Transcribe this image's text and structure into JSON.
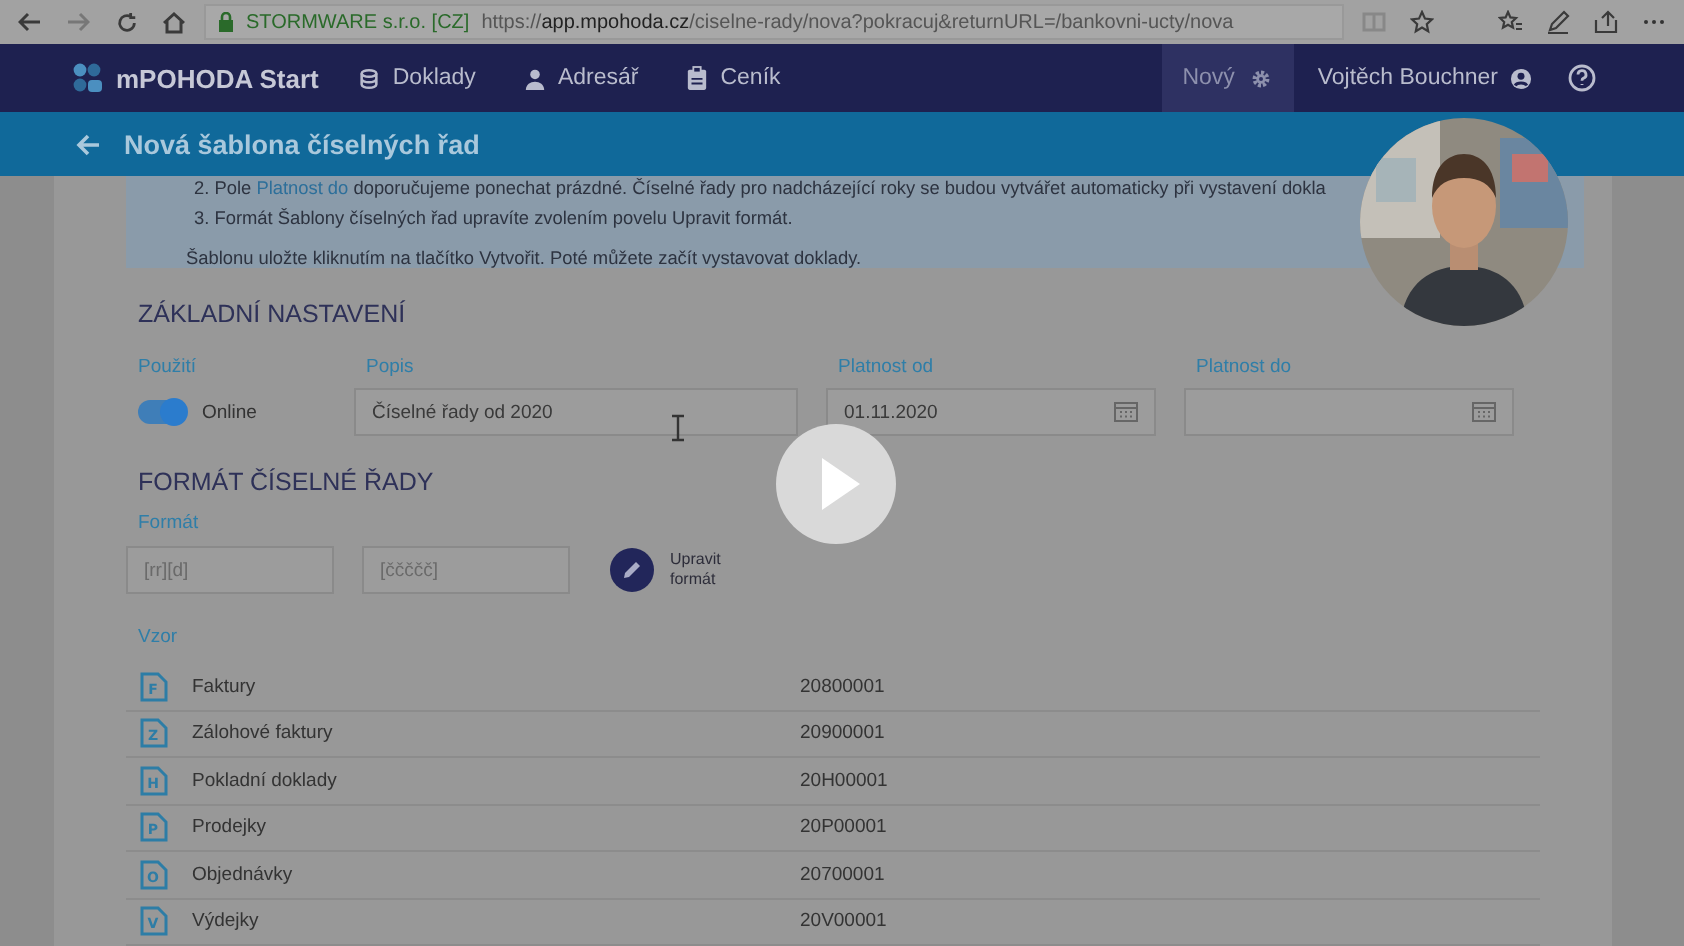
{
  "browser": {
    "site_identity": "STORMWARE s.r.o. [CZ]",
    "url": "https://**app.mpohoda.cz**/ciselne-rady/nova?pokracuj&returnURL=/bankovni-ucty/nova"
  },
  "nav": {
    "brand": "mPOHODA Start",
    "items": [
      {
        "label": "Doklady"
      },
      {
        "label": "Adresář"
      },
      {
        "label": "Ceník"
      }
    ],
    "new_button": "Nový",
    "user": "Vojtěch Bouchner"
  },
  "page_title": "Nová šablona číselných řad",
  "info": {
    "items": [
      {
        "number": "2.",
        "before": "Pole",
        "link": "Platnost do",
        "after": "doporučujeme ponechat prázdné. Číselné řady pro nadcházející roky se budou vytvářet automaticky při vystavení dokla"
      },
      {
        "number": "3.",
        "before": "Formát Šablony číselných řad upravíte zvolením povelu Upravit formát."
      }
    ],
    "note": "Šablonu uložte kliknutím na tlačítko Vytvořit. Poté můžete začít vystavovat doklady."
  },
  "basic": {
    "title": "ZÁKLADNÍ NASTAVENÍ",
    "usage": {
      "label": "Použití",
      "on": true,
      "text": "Online"
    },
    "fields": [
      {
        "kind": "text",
        "label": "Popis",
        "value": "Číselné řady od 2020"
      },
      {
        "kind": "date",
        "label": "Platnost od",
        "value": "01.11.2020"
      },
      {
        "kind": "date",
        "label": "Platnost do"
      }
    ]
  },
  "format": {
    "title": "FORMÁT ČÍSELNÉ ŘADY",
    "label": "Formát",
    "fields": [
      {
        "placeholder": "[rr][d]"
      },
      {
        "placeholder": "[ččččč]"
      }
    ],
    "edit_button": "Upravit formát"
  },
  "vzor": {
    "label": "Vzor",
    "rows": [
      {
        "letter": "F",
        "name": "Faktury",
        "code": "20800001"
      },
      {
        "letter": "Z",
        "name": "Zálohové faktury",
        "code": "20900001"
      },
      {
        "letter": "H",
        "name": "Pokladní doklady",
        "code": "20H00001"
      },
      {
        "letter": "P",
        "name": "Prodejky",
        "code": "20P00001"
      },
      {
        "letter": "O",
        "name": "Objednávky",
        "code": "20700001"
      },
      {
        "letter": "V",
        "name": "Výdejky",
        "code": "20V00001"
      }
    ]
  }
}
